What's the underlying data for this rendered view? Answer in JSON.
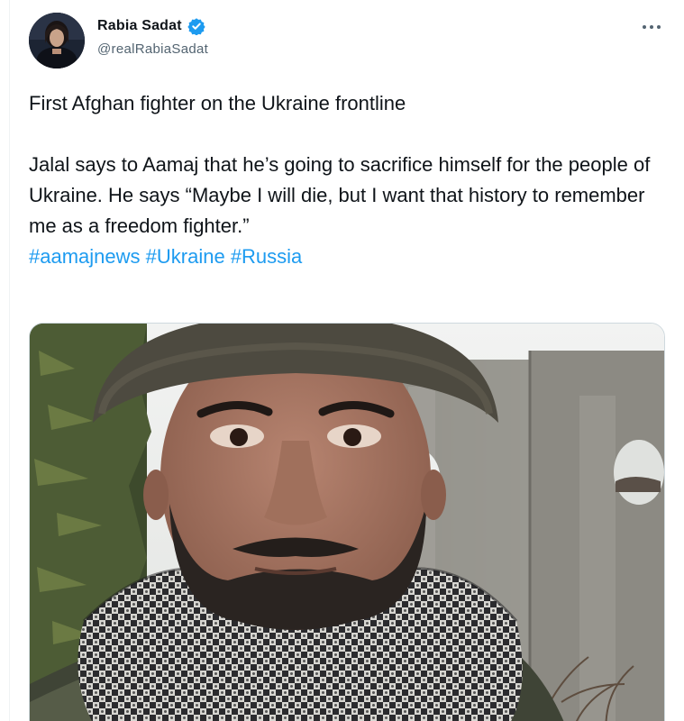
{
  "author": {
    "display_name": "Rabia Sadat",
    "handle": "@realRabiaSadat",
    "verified": true,
    "verified_color": "#1d9bf0"
  },
  "more_menu_icon": "more-horizontal-icon",
  "tweet": {
    "line1": "First Afghan fighter on the Ukraine frontline",
    "paragraph2": "Jalal says to Aamaj that he’s going to sacrifice himself for the people of Ukraine. He says “Maybe I will die, but I want that history to remember me as a freedom fighter.”",
    "hashtags": [
      "#aamajnews",
      "#Ukraine",
      "#Russia"
    ]
  },
  "colors": {
    "link": "#1d9bf0",
    "text": "#0f1419",
    "secondary": "#536471"
  }
}
